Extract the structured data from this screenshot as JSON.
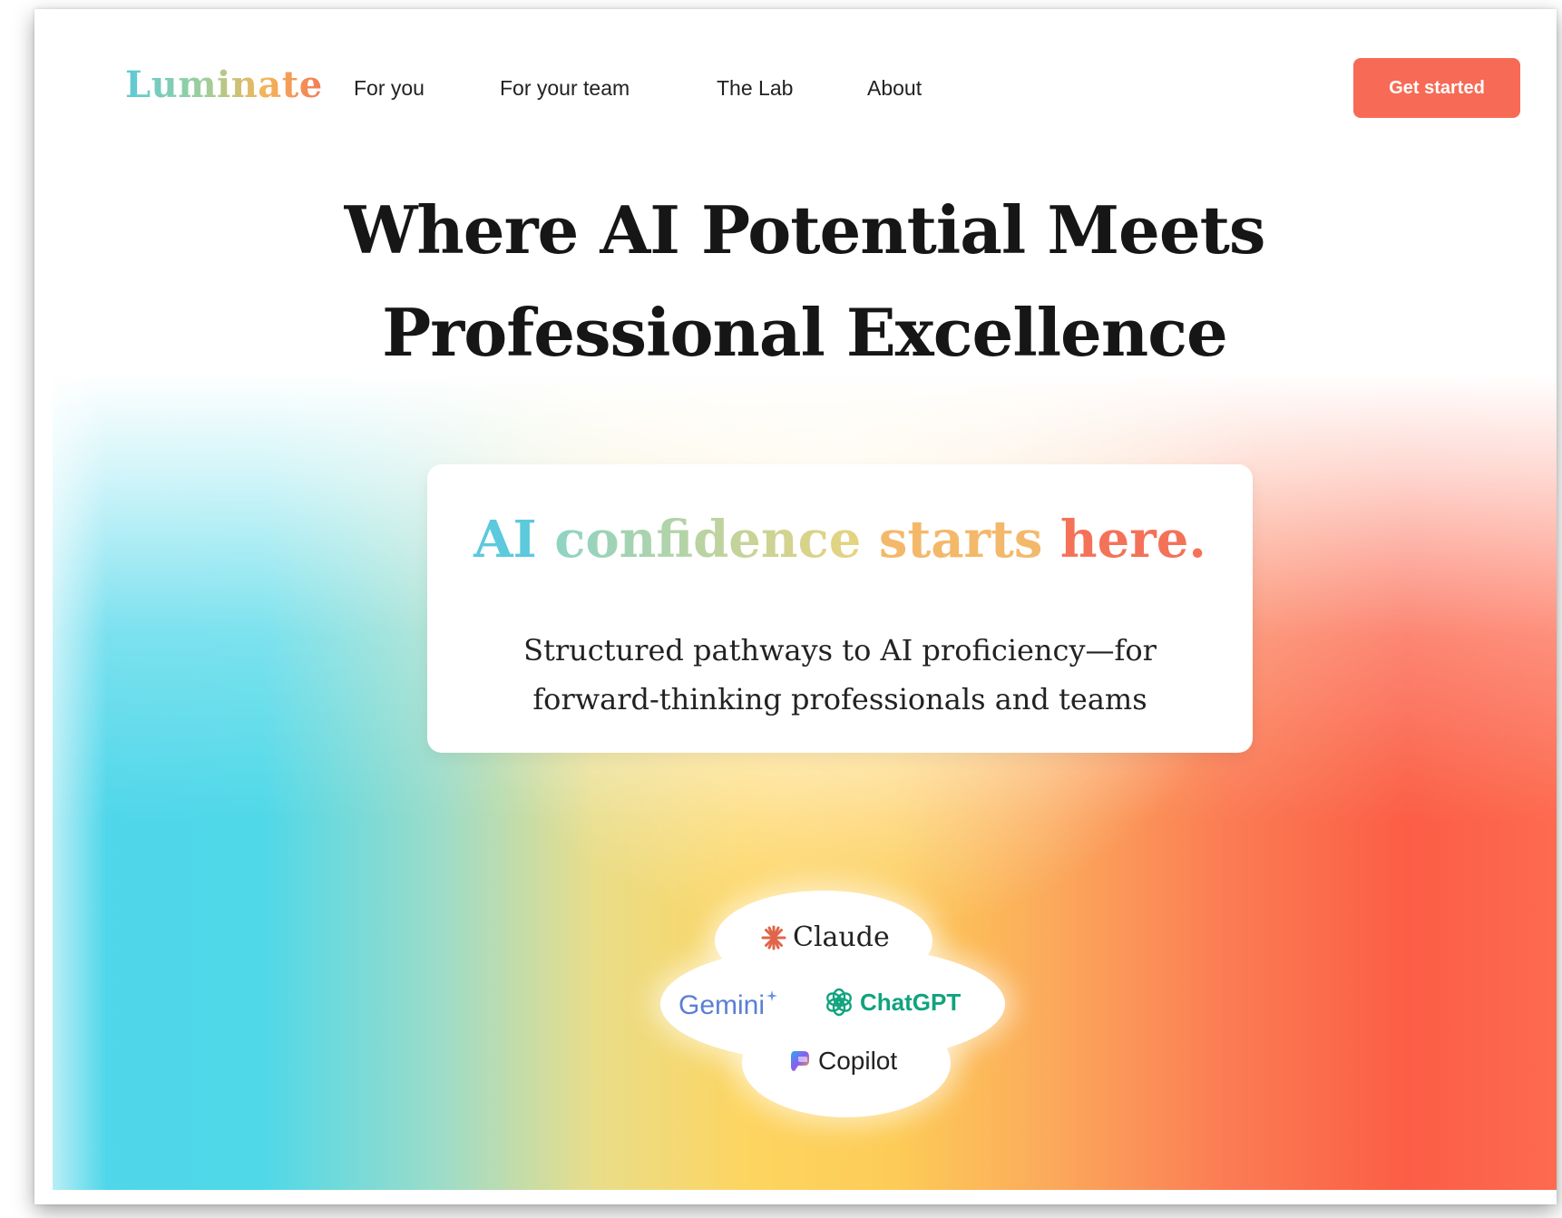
{
  "brand": {
    "name": "Luminate",
    "accent": "#f76a55"
  },
  "nav": {
    "items": [
      {
        "label": "For you"
      },
      {
        "label": "For your team"
      },
      {
        "label": "The Lab"
      },
      {
        "label": "About"
      }
    ],
    "cta_label": "Get started"
  },
  "hero": {
    "headline_line1": "Where AI Potential Meets",
    "headline_line2": "Professional Excellence",
    "card": {
      "title_parts": [
        "AI",
        "confidence",
        "starts",
        "here."
      ],
      "subtitle_line1": "Structured pathways to AI proficiency—for",
      "subtitle_line2": "forward-thinking professionals and teams"
    },
    "tools": [
      {
        "name": "Claude",
        "icon": "claude-icon"
      },
      {
        "name": "Gemini",
        "icon": "gemini-icon"
      },
      {
        "name": "ChatGPT",
        "icon": "chatgpt-icon"
      },
      {
        "name": "Copilot",
        "icon": "copilot-icon"
      }
    ]
  },
  "colors": {
    "gradient": [
      "#4fd6ea",
      "#fdd561",
      "#fb5e45"
    ],
    "headline": "#161616"
  }
}
